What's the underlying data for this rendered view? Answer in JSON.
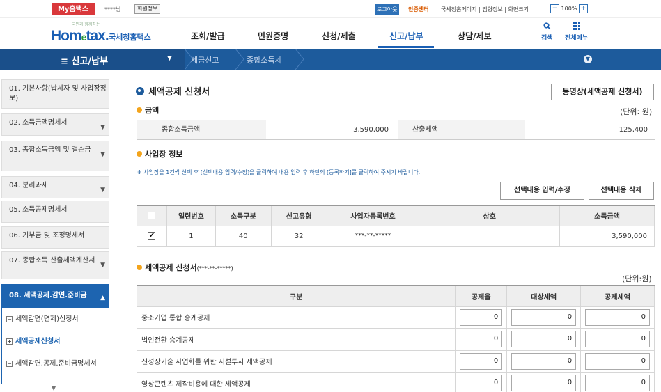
{
  "utility": {
    "my_button": "My홈택스",
    "user_text": "****님",
    "profile_button": "회원정보",
    "logout_button": "로그아웃",
    "cert_center": "인증센터",
    "links": "국세청홈페이지 | 맵형정보 | 화면크기",
    "zoom_minus": "−",
    "zoom_value": "100%",
    "zoom_plus": "+"
  },
  "header": {
    "logo_small": "국민과 함께하는",
    "logo_brand_a": "Hom",
    "logo_brand_e": "e",
    "logo_brand_b": "tax.",
    "logo_kr": "국세청홈택스",
    "menus": [
      "조회/발급",
      "민원증명",
      "신청/제출",
      "신고/납부",
      "상담/제보"
    ],
    "active_menu": "신고/납부",
    "search_label": "검색",
    "allmenu_label": "전체메뉴"
  },
  "navbar": {
    "menu_icon": "≡",
    "title": "신고/납부",
    "crumb1": "세금신고",
    "crumb2": "종합소득세"
  },
  "sidebar": {
    "items": [
      {
        "label": "01. 기본사항(납세자 및 사업장정보)",
        "expandable": false
      },
      {
        "label": "02. 소득금액명세서",
        "expandable": true
      },
      {
        "label": "03. 종합소득금액 및 결손금",
        "expandable": true
      },
      {
        "label": "04. 분리과세",
        "expandable": true
      },
      {
        "label": "05. 소득공제명세서",
        "expandable": false
      },
      {
        "label": "06. 기부금 및 조정명세서",
        "expandable": false
      },
      {
        "label": "07. 종합소득 산출세액계산서",
        "expandable": true
      },
      {
        "label": "08. 세액공제.감면.준비금",
        "expandable": true
      }
    ],
    "sub_items": [
      {
        "label": "세액감면(면제)신청서",
        "box": "−",
        "active": false
      },
      {
        "label": "세액공제신청서",
        "box": "+",
        "active": true
      },
      {
        "label": "세액감면.공제.준비금명세서",
        "box": "−",
        "active": false
      }
    ]
  },
  "main": {
    "title": "세액공제 신청서",
    "video_button": "동영상(세액공제 신청서)",
    "amount_section": "금액",
    "amount_unit": "(단위: 원)",
    "total_income_label": "종합소득금액",
    "total_income_value": "3,590,000",
    "calc_tax_label": "산출세액",
    "calc_tax_value": "125,400",
    "biz_section": "사업장 정보",
    "notice": "※ 사업장을 1건씩 선택 후 [선택내용 입력/수정]을 클릭하여 내용 입력 후 하단의 [등록하기]를 클릭하여 주시기 바랍니다.",
    "edit_button": "선택내용 입력/수정",
    "delete_button": "선택내용 삭제",
    "biz_headers": [
      "일련번호",
      "소득구분",
      "신고유형",
      "사업자등록번호",
      "상호",
      "소득금액"
    ],
    "biz_rows": [
      {
        "checked": true,
        "serial": "1",
        "income_type": "40",
        "report_type": "32",
        "reg_no": "***-**-*****",
        "name": "",
        "amount": "3,590,000"
      }
    ],
    "ded_section": "세액공제 신청서",
    "ded_section_id": "(***-**-*****)",
    "ded_unit": "(단위:원)",
    "ded_headers": [
      "구분",
      "공제율",
      "대상세액",
      "공제세액"
    ],
    "ded_rows": [
      {
        "label": "중소기업 통합 승계공제",
        "rate": "0",
        "target": "0",
        "deduct": "0"
      },
      {
        "label": "법인전환 승계공제",
        "rate": "0",
        "target": "0",
        "deduct": "0"
      },
      {
        "label": "신성장기술 사업화를 위한 시설투자 세액공제",
        "rate": "0",
        "target": "0",
        "deduct": "0"
      },
      {
        "label": "영상콘텐츠 제작비용에 대한 세액공제",
        "rate": "0",
        "target": "0",
        "deduct": "0"
      }
    ]
  },
  "colors": {
    "brand_blue": "#1d5b9c",
    "accent_red": "#d9383b",
    "bullet_orange": "#f3a41c"
  }
}
